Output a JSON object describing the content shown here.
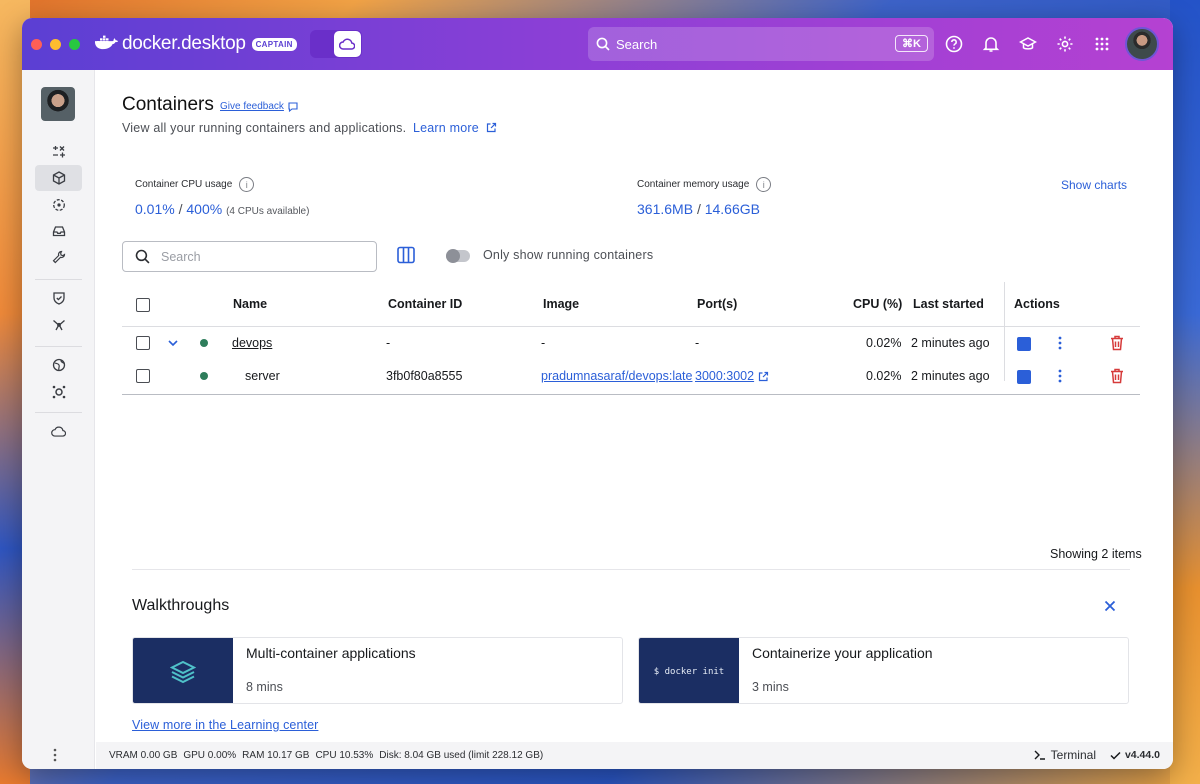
{
  "titlebar": {
    "brand": "docker.desktop",
    "badge": "CAPTAIN",
    "search_placeholder": "Search",
    "shortcut": "⌘K",
    "colors": {
      "gradient_start": "#5b3fd3",
      "gradient_end": "#b541d2",
      "accent": "#2b5fd8"
    }
  },
  "sidebar": {
    "icons": [
      "containers-icon",
      "images-icon",
      "volumes-icon",
      "builds-icon",
      "scout-icon",
      "extensions-icon",
      "kubernetes-icon",
      "models-icon",
      "cloud-icon"
    ]
  },
  "page": {
    "title": "Containers",
    "feedback": "Give feedback",
    "subtitle": "View all your running containers and applications.",
    "learn_more": "Learn more",
    "cpu_label": "Container CPU usage",
    "cpu_value": "0.01%",
    "cpu_sep": "/",
    "cpu_total": "400%",
    "cpu_note": "(4 CPUs available)",
    "mem_label": "Container memory usage",
    "mem_value": "361.6MB",
    "mem_sep": "/",
    "mem_total": "14.66GB",
    "show_charts": "Show charts",
    "search_placeholder": "Search",
    "toggle_label": "Only show running containers",
    "showing": "Showing 2 items"
  },
  "table": {
    "headers": [
      "Name",
      "Container ID",
      "Image",
      "Port(s)",
      "CPU (%)",
      "Last started",
      "Actions"
    ],
    "rows": [
      {
        "name": "devops",
        "id": "-",
        "image": "-",
        "ports": "-",
        "cpu": "0.02%",
        "started": "2 minutes ago"
      },
      {
        "name": "server",
        "id": "3fb0f80a8555",
        "image": "pradumnasaraf/devops:late",
        "ports": "3000:3002",
        "cpu": "0.02%",
        "started": "2 minutes ago"
      }
    ]
  },
  "walkthroughs": {
    "title": "Walkthroughs",
    "cards": [
      {
        "title": "Multi-container applications",
        "meta": "8 mins"
      },
      {
        "title": "Containerize your application",
        "meta": "3 mins",
        "thumb_text": "$ docker init"
      }
    ],
    "view_more": "View more in the Learning center"
  },
  "footer": {
    "vram": "VRAM 0.00 GB",
    "gpu": "GPU 0.00%",
    "ram": "RAM 10.17 GB",
    "cpu": "CPU 10.53%",
    "disk": "Disk: 8.04 GB used (limit 228.12 GB)",
    "terminal": "Terminal",
    "version": "v4.44.0"
  }
}
